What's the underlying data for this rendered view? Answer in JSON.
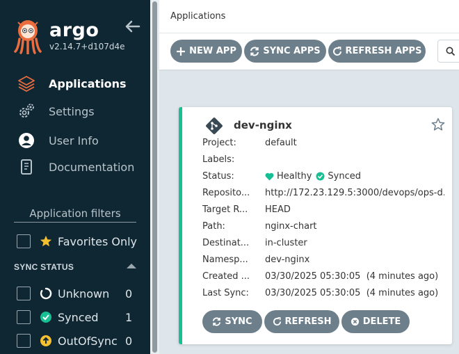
{
  "sidebar": {
    "brand": "argo",
    "version": "v2.14.7+d107d4e",
    "nav": [
      {
        "label": "Applications",
        "icon": "layers-icon",
        "active": true
      },
      {
        "label": "Settings",
        "icon": "gears-icon"
      },
      {
        "label": "User Info",
        "icon": "user-circle-icon"
      },
      {
        "label": "Documentation",
        "icon": "book-icon"
      }
    ],
    "filters_title": "Application filters",
    "favorites_label": "Favorites Only",
    "sync_status_heading": "SYNC STATUS",
    "sync_filters": [
      {
        "label": "Unknown",
        "count": "0",
        "icon": "circle-notch-icon"
      },
      {
        "label": "Synced",
        "count": "1",
        "icon": "check-circle-icon"
      },
      {
        "label": "OutOfSync",
        "count": "0",
        "icon": "arrow-up-circle-icon"
      }
    ]
  },
  "header": {
    "title": "Applications"
  },
  "toolbar": {
    "new_app": "NEW APP",
    "sync_apps": "SYNC APPS",
    "refresh_apps": "REFRESH APPS"
  },
  "card": {
    "name": "dev-nginx",
    "rows": [
      {
        "key": "Project:",
        "value": "default"
      },
      {
        "key": "Labels:",
        "value": ""
      },
      {
        "key": "Status:",
        "health": "Healthy",
        "sync": "Synced"
      },
      {
        "key": "Reposito...",
        "value": "http://172.23.129.5:3000/devops/ops-d..."
      },
      {
        "key": "Target R...",
        "value": "HEAD"
      },
      {
        "key": "Path:",
        "value": "nginx-chart"
      },
      {
        "key": "Destinat...",
        "value": "in-cluster"
      },
      {
        "key": "Namesp...",
        "value": "dev-nginx"
      },
      {
        "key": "Created ...",
        "value": "03/30/2025 05:30:05  (4 minutes ago)"
      },
      {
        "key": "Last Sync:",
        "value": "03/30/2025 05:30:05  (4 minutes ago)"
      }
    ],
    "buttons": {
      "sync": "SYNC",
      "refresh": "REFRESH",
      "delete": "DELETE"
    }
  },
  "colors": {
    "sidebar_bg": "#0f2733",
    "healthy": "#18be94",
    "button": "#6d7f8b",
    "out_of_sync": "#f4c030",
    "active_icon": "#e96d3f"
  }
}
